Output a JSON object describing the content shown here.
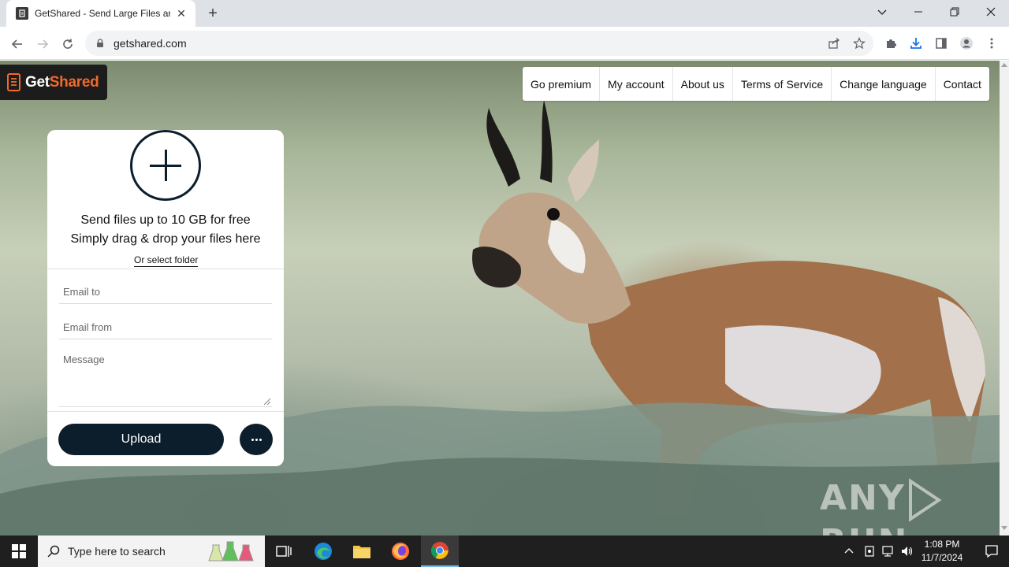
{
  "browser": {
    "tab_title": "GetShared - Send Large Files and Photos",
    "url": "getshared.com",
    "new_tab_label": "+"
  },
  "site": {
    "logo_text_main": "Get",
    "logo_text_accent": "Shared",
    "logo_accent_color": "#f06a2a",
    "nav": [
      "Go premium",
      "My account",
      "About us",
      "Terms of Service",
      "Change language",
      "Contact"
    ]
  },
  "upload_card": {
    "line1": "Send files up to 10 GB for free",
    "line2": "Simply drag & drop your files here",
    "select_folder": "Or select folder",
    "email_to_placeholder": "Email to",
    "email_from_placeholder": "Email from",
    "message_placeholder": "Message",
    "upload_label": "Upload",
    "button_color": "#0c1e2c"
  },
  "watermark": {
    "text_left": "ANY",
    "text_right": "RUN"
  },
  "taskbar": {
    "search_placeholder": "Type here to search",
    "time": "1:08 PM",
    "date": "11/7/2024"
  }
}
